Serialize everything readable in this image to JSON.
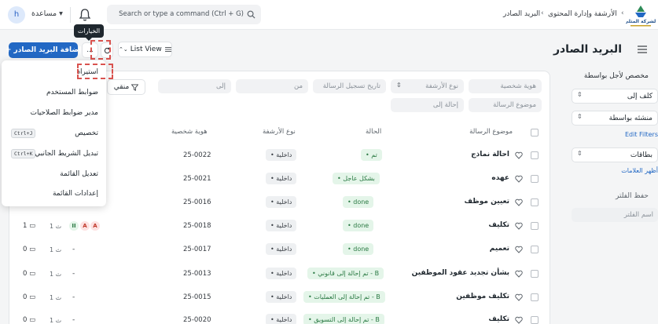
{
  "navbar": {
    "user_initial": "h",
    "help_label": "مساعدة ▾",
    "search_placeholder": "Search or type a command (Ctrl + G)",
    "breadcrumb": [
      "الأرشفة وإدارة المحتوى",
      "البريد الصادر"
    ],
    "logo_text": "الشركة المثلى"
  },
  "header": {
    "title": "البريد الصادر",
    "add_button": "+ إضافة البريد الصادر",
    "more_button": "...",
    "view_button": "List View",
    "tooltip": "الخيارات"
  },
  "sidebar": {
    "assigned_label": "مخصص لأجل",
    "by_label": "بواسطة",
    "select_assigned": "كلف إلى",
    "select_created": "منشئه بواسطة",
    "edit_filters": "Edit Filters",
    "select_tags": "بطاقات",
    "show_tags": "أظهر العلامات",
    "save_filter": "حفظ الفلتر",
    "filter_name_placeholder": "اسم الفلتر"
  },
  "filters": {
    "identity": "هوية شخصية",
    "archive_type": "نوع الأرشفة",
    "date": "تاريخ تسجيل الرسالة",
    "from": "من",
    "to": "إلى",
    "subject": "موضوع الرسالة",
    "referred": "إحالة إلى",
    "filter_button": "منقي"
  },
  "columns": {
    "subject": "موضوع الرسالة",
    "status": "الحالة",
    "archive_type": "نوع الأرشفة",
    "identity": "هوية شخصية"
  },
  "rows": [
    {
      "title": "احالة نماذج",
      "status": "• تم",
      "type": "• داخلية",
      "id": "25-0022",
      "dash": "",
      "since": "",
      "comments": ""
    },
    {
      "title": "عهده",
      "status": "• بشكل عاجل",
      "type": "• داخلية",
      "id": "25-0021",
      "dash": "",
      "since": "",
      "comments": ""
    },
    {
      "title": "تعيين موظف",
      "status": "• done",
      "type": "• داخلية",
      "id": "25-0016",
      "dash": "",
      "since": "",
      "comments": ""
    },
    {
      "title": "تكليف",
      "status": "• done",
      "type": "• داخلية",
      "id": "25-0018",
      "dash": "",
      "since": "1 ث",
      "comments": "1"
    },
    {
      "title": "تعميم",
      "status": "• done",
      "type": "• داخلية",
      "id": "25-0017",
      "dash": "-",
      "since": "1 ث",
      "comments": "0"
    },
    {
      "title": "بشأن تجديد عقود الموظفين",
      "status": "• تم إحالة إلى قانوني - B",
      "type": "• داخلية",
      "id": "25-0013",
      "dash": "-",
      "since": "1 ث",
      "comments": "0"
    },
    {
      "title": "تكليف موظفين",
      "status": "• تم إحالة إلى العمليات - B",
      "type": "• داخلية",
      "id": "25-0015",
      "dash": "-",
      "since": "1 ث",
      "comments": "0"
    },
    {
      "title": "تكليف",
      "status": "• تم إحالة إلى التسويق - B",
      "type": "• داخلية",
      "id": "25-0020",
      "dash": "-",
      "since": "1 ث",
      "comments": "0"
    }
  ],
  "avatars": [
    "A",
    "A",
    "II"
  ],
  "menu": {
    "items": [
      {
        "label": "استيراد",
        "shortcut": ""
      },
      {
        "label": "ضوابط المستخدم",
        "shortcut": ""
      },
      {
        "label": "مدير ضوابط الصلاحيات",
        "shortcut": ""
      },
      {
        "label": "تخصيص",
        "shortcut": "Ctrl+J"
      },
      {
        "label": "تبديل الشريط الجانبي",
        "shortcut": "Ctrl+K"
      },
      {
        "label": "تعديل القائمة",
        "shortcut": ""
      },
      {
        "label": "إعدادات القائمة",
        "shortcut": ""
      }
    ]
  },
  "colors": {
    "primary": "#2268c4",
    "highlight": "#d9534f"
  }
}
